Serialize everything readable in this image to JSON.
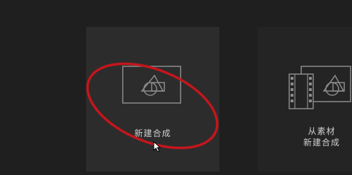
{
  "cards": [
    {
      "id": "new-composition",
      "label": "新建合成",
      "icon": "composition-icon"
    },
    {
      "id": "new-composition-from-footage",
      "label_line1": "从素材",
      "label_line2": "新建合成",
      "icon": "footage-composition-icon"
    }
  ],
  "colors": {
    "background": "#1f1f1f",
    "card_highlight": "#2c2c2c",
    "card": "#242424",
    "icon_stroke": "#8c8c8c",
    "label": "#cfcfcf",
    "annotation": "#c3161c"
  }
}
